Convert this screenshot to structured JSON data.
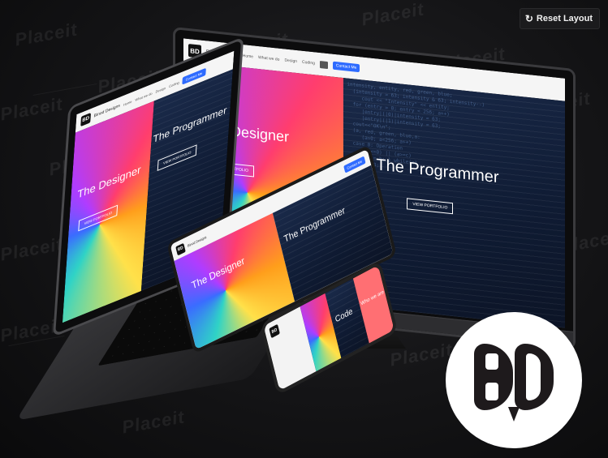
{
  "toolbar": {
    "reset_label": "Reset Layout",
    "reset_icon": "reset-icon"
  },
  "watermark": "Placeit",
  "site": {
    "brand": "Binod Designs",
    "logo_letters": "BD",
    "nav_links": [
      "Home",
      "What we do",
      "Design",
      "Coding"
    ],
    "contact_label": "Contact Me",
    "hero_left_title": "The Designer",
    "hero_right_title": "The Programmer",
    "portfolio_label": "VIEW PORTFOLIO",
    "code_label": "Code",
    "who_label": "Who we are"
  },
  "colors": {
    "accent": "#2e6bff",
    "background": "#141416",
    "logo_dark": "#1e1a1c",
    "phone_panel": "#ff6f73"
  }
}
